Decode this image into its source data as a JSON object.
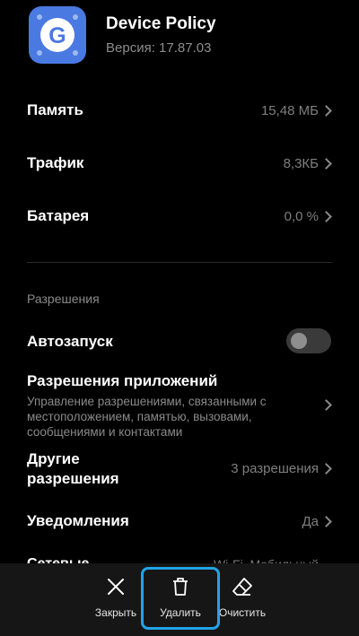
{
  "app": {
    "name": "Device Policy",
    "version": "Версия: 17.87.03",
    "icon": "google-g-icon",
    "icon_color": "#4a79e1"
  },
  "storage": {
    "label": "Память",
    "value": "15,48 МБ"
  },
  "traffic": {
    "label": "Трафик",
    "value": "8,3КБ"
  },
  "battery": {
    "label": "Батарея",
    "value": "0,0 %"
  },
  "permissions_section": {
    "title": "Разрешения"
  },
  "autostart": {
    "label": "Автозапуск",
    "enabled": false
  },
  "app_permissions": {
    "label": "Разрешения приложений",
    "description": "Управление разрешениями, связанными с местоположением, памятью, вызовами, сообщениями и контактами"
  },
  "other_permissions": {
    "label_line1": "Другие",
    "label_line2": "разрешения",
    "value": "3 разрешения"
  },
  "notifications": {
    "label": "Уведомления",
    "value": "Да"
  },
  "partially_hidden_row": {
    "label": "Сетевые",
    "value": "Wi-Fi, Мобильный"
  },
  "bottom_actions": {
    "close": {
      "label": "Закрыть",
      "icon": "close-icon"
    },
    "uninstall": {
      "label": "Удалить",
      "icon": "trash-icon"
    },
    "clear": {
      "label": "Очистить",
      "icon": "eraser-icon"
    }
  },
  "colors": {
    "background": "#000000",
    "highlight": "#22a3e6",
    "toolbar": "#161616"
  }
}
